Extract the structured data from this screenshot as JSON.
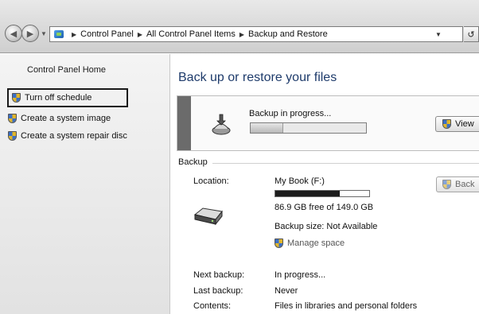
{
  "addressbar": {
    "breadcrumbs": [
      "Control Panel",
      "All Control Panel Items",
      "Backup and Restore"
    ],
    "dropdown_icon": "chevron-down-icon",
    "refresh_icon": "refresh-icon"
  },
  "sidebar": {
    "home_link": "Control Panel Home",
    "tasks": [
      {
        "label": "Turn off schedule",
        "icon": "shield-icon"
      },
      {
        "label": "Create a system image",
        "icon": "shield-icon"
      },
      {
        "label": "Create a system repair disc",
        "icon": "shield-icon"
      }
    ]
  },
  "main": {
    "title": "Back up or restore your files",
    "progress": {
      "label": "Backup in progress...",
      "fraction": 0.28,
      "view_button": "View"
    },
    "backup": {
      "section_label": "Backup",
      "location_label": "Location:",
      "location_value": "My Book (F:)",
      "drive_used_fraction": 0.69,
      "free_space": "86.9 GB free of 149.0 GB",
      "backup_size": "Backup size: Not Available",
      "manage_space": "Manage space",
      "back_button": "Back",
      "next_backup_label": "Next backup:",
      "next_backup_value": "In progress...",
      "last_backup_label": "Last backup:",
      "last_backup_value": "Never",
      "contents_label": "Contents:",
      "contents_value": "Files in libraries and personal folders"
    }
  },
  "colors": {
    "title_blue": "#1e3b6b",
    "highlight_border": "#1a1a1a",
    "progress_stripe": "#6b6b6b"
  }
}
